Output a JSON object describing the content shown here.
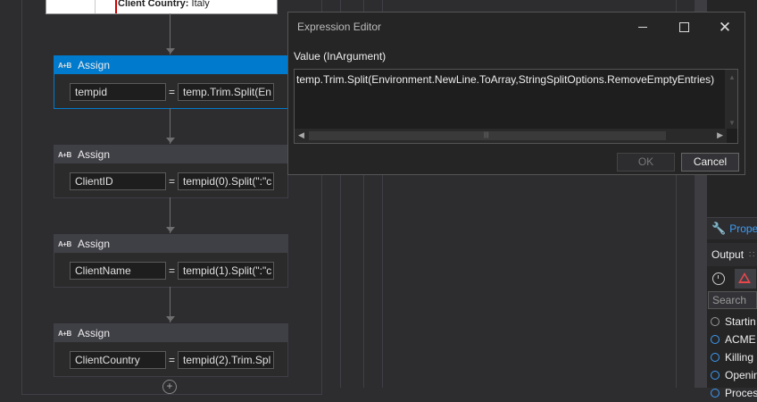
{
  "designer": {
    "top_card": {
      "label": "Client Country:",
      "value": "Italy"
    },
    "activities": [
      {
        "title": "Assign",
        "icon": "A+B",
        "to": "tempid",
        "value": "temp.Trim.Split(En"
      },
      {
        "title": "Assign",
        "icon": "A+B",
        "to": "ClientID",
        "value": "tempid(0).Split(\":\"c"
      },
      {
        "title": "Assign",
        "icon": "A+B",
        "to": "ClientName",
        "value": "tempid(1).Split(\":\"c"
      },
      {
        "title": "Assign",
        "icon": "A+B",
        "to": "ClientCountry",
        "value": "tempid(2).Trim.Spl"
      }
    ],
    "equals": "="
  },
  "dialog": {
    "title": "Expression Editor",
    "value_label": "Value (InArgument)",
    "expression": "temp.Trim.Split(Environment.NewLine.ToArray,StringSplitOptions.RemoveEmptyEntries)",
    "ok_label": "OK",
    "cancel_label": "Cancel"
  },
  "right_panel": {
    "properties_label": "Prope",
    "output_label": "Output",
    "search_placeholder": "Search",
    "items": [
      "Startin",
      "ACME",
      "Killing",
      "Openin",
      "Proces"
    ]
  }
}
